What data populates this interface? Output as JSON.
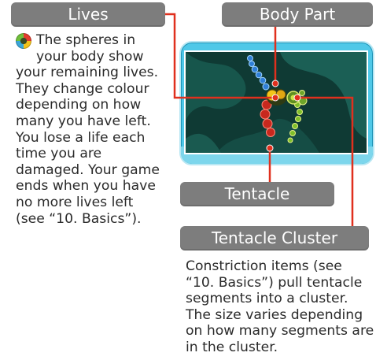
{
  "labels": {
    "lives": "Lives",
    "body_part": "Body Part",
    "tentacle": "Tentacle",
    "tentacle_cluster": "Tentacle Cluster"
  },
  "lives_paragraph": "The spheres in your body show your remaining lives. They change colour depending on how many you have left. You lose a life each time you are damaged. Your game ends when you have no more lives left (see “10. Basics”).",
  "cluster_paragraph": "Constriction items (see “10. Basics”) pull tentacle segments into a cluster. The size varies depending on how many segments are in the cluster.",
  "colors": {
    "label_background": "#7d7d7d",
    "leader_line": "#e0301e",
    "screen_frame": "#4fc8e8",
    "game_background": "#0f3a34"
  },
  "icons": {
    "lives_icon": "lives-sphere-icon"
  }
}
